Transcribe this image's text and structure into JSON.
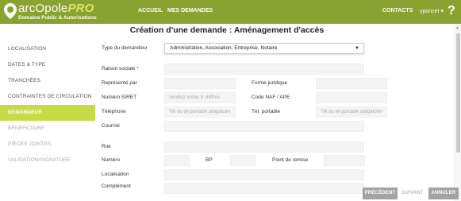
{
  "header": {
    "logo_title": "arcOpole",
    "logo_title_pro": "PRO",
    "logo_subtitle": "Domaine Public & Autorisations",
    "nav": {
      "accueil": "ACCUEIL",
      "mes_demandes": "MES DEMANDES",
      "contacts": "CONTACTS",
      "user": "yponcet ▾"
    },
    "help": "?"
  },
  "page_title": "Création d'une demande : Aménagement d'accès",
  "sidebar": {
    "items": [
      {
        "label": "LOCALISATION",
        "state": "normal"
      },
      {
        "label": "DATES & TYPE",
        "state": "normal"
      },
      {
        "label": "TRANCHÉES",
        "state": "normal"
      },
      {
        "label": "CONTRAINTES DE CIRCULATION",
        "state": "normal"
      },
      {
        "label": "DEMANDEUR",
        "state": "active"
      },
      {
        "label": "BÉNÉFICIAIRE",
        "state": "disabled"
      },
      {
        "label": "PIÈCES JOINTES",
        "state": "disabled"
      },
      {
        "label": "VALIDATION/SIGNATURE",
        "state": "disabled"
      }
    ]
  },
  "form": {
    "type_demandeur_label": "Type du demandeur",
    "type_demandeur_value": "Administration, Association, Entreprise, Notaire",
    "raison_sociale_label": "Raison sociale",
    "required_mark": "*",
    "represente_par_label": "Représenté par",
    "forme_juridique_label": "Forme juridique",
    "siret_label": "Numéro SIRET",
    "siret_placeholder": "Veuillez entrer 9 chiffres",
    "naf_label": "Code NAF / APE",
    "telephone_label": "Téléphone",
    "telephone_placeholder": "Tél ou tél portable obligatoire",
    "tel_portable_label": "Tél. portable",
    "tel_portable_placeholder": "Tél ou tél portable obligatoire",
    "courriel_label": "Courriel",
    "rue_label": "Rue",
    "numero_label": "Numéro",
    "bp_label": "BP",
    "point_remise_label": "Point de remise",
    "localisation_label": "Localisation",
    "complement_label": "Complément"
  },
  "buttons": {
    "precedent": "PRÉCÉDENT",
    "suivant": "SUIVANT",
    "annuler": "ANNULER"
  },
  "colors": {
    "brand": "#8aa22f",
    "active": "#c6dc46",
    "required": "#d9232e"
  }
}
